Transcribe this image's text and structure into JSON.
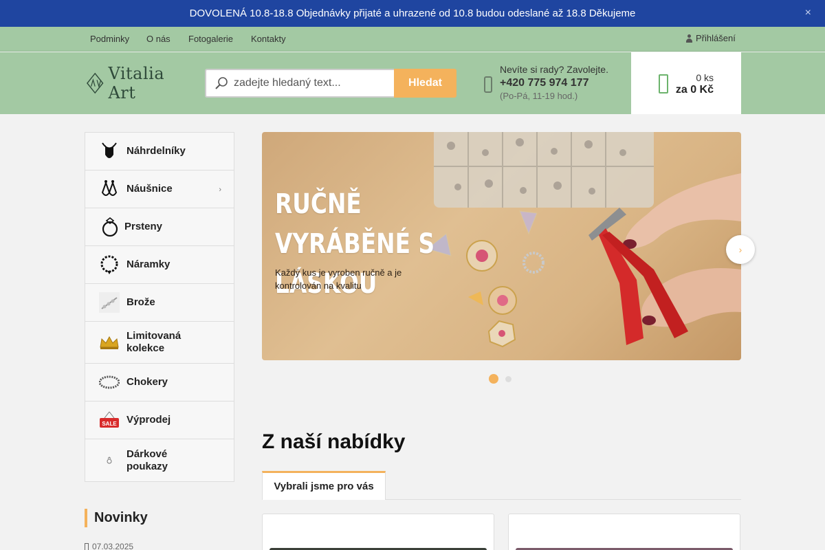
{
  "notice": {
    "text": "DOVOLENÁ 10.8-18.8 Objednávky přijaté a uhrazené od 10.8 budou odeslané až 18.8 Děkujeme",
    "close": "×"
  },
  "topnav": {
    "links": [
      "Podminky",
      "O nás",
      "Fotogalerie",
      "Kontakty"
    ],
    "login": "Přihlášení"
  },
  "header": {
    "logo_text": "Vitalia Art",
    "search_placeholder": "zadejte hledaný text...",
    "search_button": "Hledat",
    "help_line": "Nevíte si rady? Zavolejte.",
    "phone": "+420 775 974 177",
    "hours": "(Po-Pá, 11-19 hod.)",
    "cart_count": "0 ks",
    "cart_total": "za 0 Kč"
  },
  "categories": [
    {
      "label": "Náhrdelníky",
      "icon": "necklace-icon"
    },
    {
      "label": "Náušnice",
      "icon": "earrings-icon",
      "has_submenu": true
    },
    {
      "label": "Prsteny",
      "icon": "ring-icon"
    },
    {
      "label": "Náramky",
      "icon": "bracelet-icon"
    },
    {
      "label": "Brože",
      "icon": "brooch-icon"
    },
    {
      "label": "Limitovaná kolekce",
      "icon": "crown-icon"
    },
    {
      "label": "Chokery",
      "icon": "choker-icon"
    },
    {
      "label": "Výprodej",
      "icon": "sale-icon"
    },
    {
      "label": "Dárkové poukazy",
      "icon": "gift-voucher-icon"
    }
  ],
  "banner": {
    "title": "RUČNĚ VYRÁBĚNÉ S LÁSKOU",
    "subtitle": "Každý kus je vyroben ručně a je kontrolován na kvalitu",
    "slides": 2,
    "active_slide": 1
  },
  "news": {
    "heading": "Novinky",
    "date": "07.03.2025"
  },
  "offer": {
    "heading": "Z naší nabídky",
    "tab": "Vybrali jsme pro vás"
  },
  "colors": {
    "notice_bg": "#1f45a0",
    "header_bg": "#a3c9a3",
    "accent": "#f4b25c"
  }
}
